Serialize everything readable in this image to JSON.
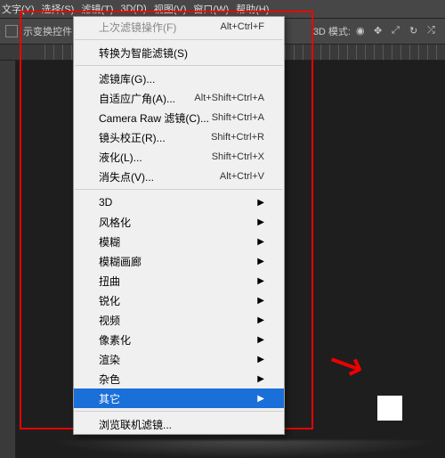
{
  "menubar": {
    "items": [
      "文字(Y)",
      "选择(S)",
      "滤镜(T)",
      "3D(D)",
      "视图(V)",
      "窗口(W)",
      "帮助(H)"
    ]
  },
  "toolbar": {
    "left_label": "示变换控件",
    "mode_label": "3D 模式:"
  },
  "menu": {
    "section1": [
      {
        "label": "上次滤镜操作(F)",
        "shortcut": "Alt+Ctrl+F"
      }
    ],
    "section2": [
      {
        "label": "转换为智能滤镜(S)"
      }
    ],
    "section3": [
      {
        "label": "滤镜库(G)..."
      },
      {
        "label": "自适应广角(A)...",
        "shortcut": "Alt+Shift+Ctrl+A"
      },
      {
        "label": "Camera Raw 滤镜(C)...",
        "shortcut": "Shift+Ctrl+A"
      },
      {
        "label": "镜头校正(R)...",
        "shortcut": "Shift+Ctrl+R"
      },
      {
        "label": "液化(L)...",
        "shortcut": "Shift+Ctrl+X"
      },
      {
        "label": "消失点(V)...",
        "shortcut": "Alt+Ctrl+V"
      }
    ],
    "section4": [
      {
        "label": "3D",
        "sub": true
      },
      {
        "label": "风格化",
        "sub": true
      },
      {
        "label": "模糊",
        "sub": true
      },
      {
        "label": "模糊画廊",
        "sub": true
      },
      {
        "label": "扭曲",
        "sub": true
      },
      {
        "label": "锐化",
        "sub": true
      },
      {
        "label": "视频",
        "sub": true
      },
      {
        "label": "像素化",
        "sub": true
      },
      {
        "label": "渲染",
        "sub": true
      },
      {
        "label": "杂色",
        "sub": true
      },
      {
        "label": "其它",
        "sub": true,
        "highlight": true
      }
    ],
    "section5": [
      {
        "label": "浏览联机滤镜..."
      }
    ]
  }
}
